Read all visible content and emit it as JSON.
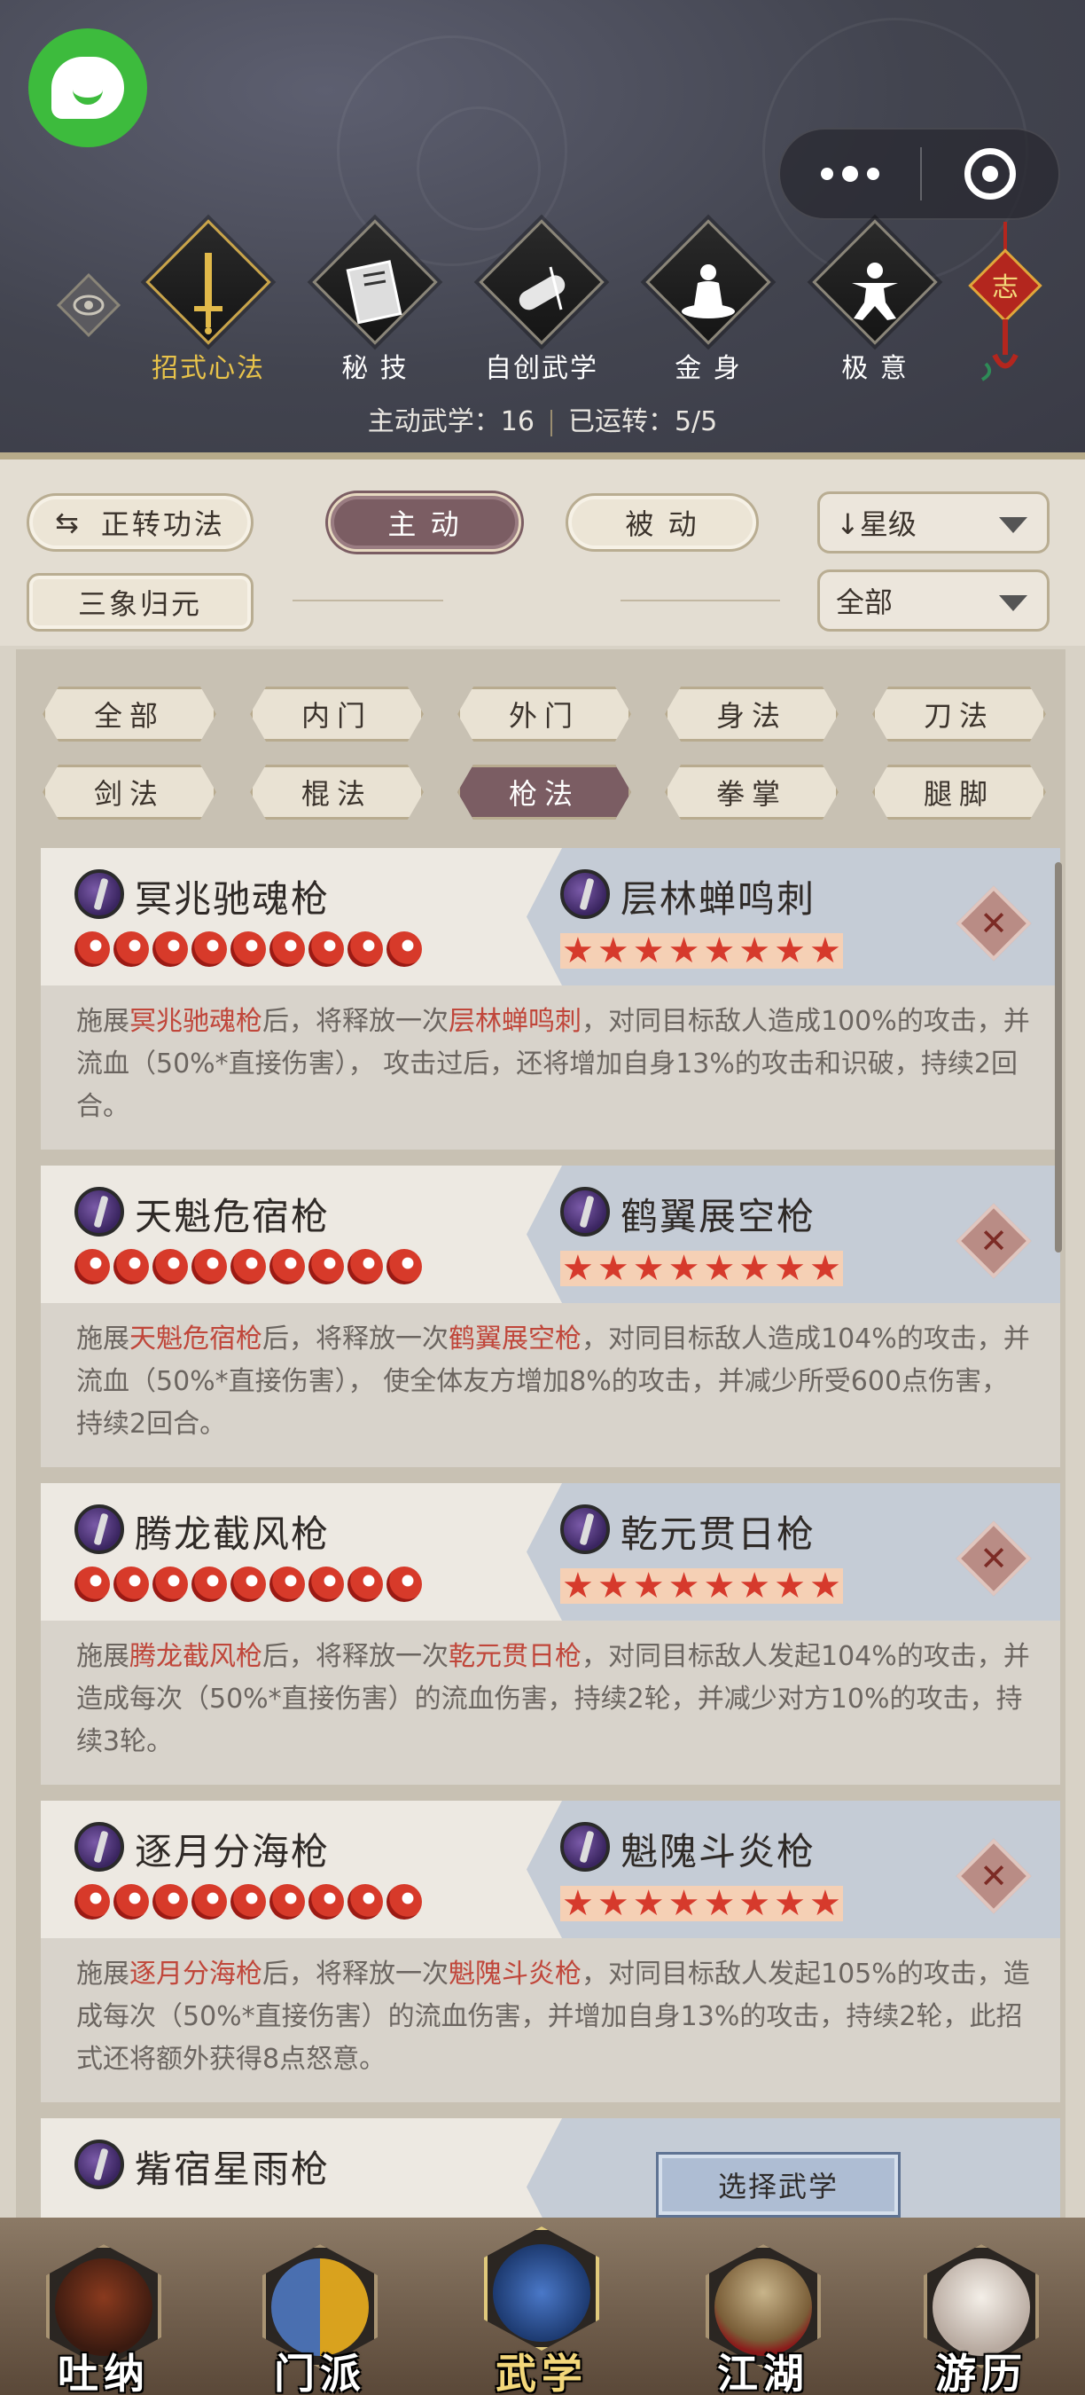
{
  "header": {
    "top_tabs": [
      {
        "label": "招式心法",
        "icon": "sword-icon",
        "active": true
      },
      {
        "label": "秘 技",
        "icon": "book-icon",
        "active": false
      },
      {
        "label": "自创武学",
        "icon": "scroll-icon",
        "active": false
      },
      {
        "label": "金 身",
        "icon": "meditation-icon",
        "active": false
      },
      {
        "label": "极 意",
        "icon": "martial-pose-icon",
        "active": false
      }
    ],
    "knot_char": "志",
    "status": {
      "active_label": "主动武学：16",
      "running_label": "已运转：5/5"
    }
  },
  "toolbar": {
    "switch_label": "正转功法",
    "active_label": "主 动",
    "passive_label": "被 动",
    "sort_label": "↓星级",
    "sanxiang_label": "三象归元",
    "filter_all_label": "全部"
  },
  "filters": [
    {
      "label": "全部",
      "active": false
    },
    {
      "label": "内门",
      "active": false
    },
    {
      "label": "外门",
      "active": false
    },
    {
      "label": "身法",
      "active": false
    },
    {
      "label": "刀法",
      "active": false
    },
    {
      "label": "剑法",
      "active": false
    },
    {
      "label": "棍法",
      "active": false
    },
    {
      "label": "枪法",
      "active": true
    },
    {
      "label": "拳掌",
      "active": false
    },
    {
      "label": "腿脚",
      "active": false
    }
  ],
  "combos": [
    {
      "left_name": "冥兆驰魂枪",
      "flames": 9,
      "right_name": "层林蝉鸣刺",
      "stars": 8,
      "desc_pre": "施展",
      "desc_hl1": "冥兆驰魂枪",
      "desc_mid": "后，将释放一次",
      "desc_hl2": "层林蝉鸣刺",
      "desc_post": "，对同目标敌人造成100%的攻击，并流血（50%*直接伤害）， 攻击过后，还将增加自身13%的攻击和识破，持续2回合。"
    },
    {
      "left_name": "天魁危宿枪",
      "flames": 9,
      "right_name": "鹤翼展空枪",
      "stars": 8,
      "desc_pre": "施展",
      "desc_hl1": "天魁危宿枪",
      "desc_mid": "后，将释放一次",
      "desc_hl2": "鹤翼展空枪",
      "desc_post": "，对同目标敌人造成104%的攻击，并流血（50%*直接伤害）， 使全体友方增加8%的攻击，并减少所受600点伤害，持续2回合。"
    },
    {
      "left_name": "腾龙截风枪",
      "flames": 9,
      "right_name": "乾元贯日枪",
      "stars": 8,
      "desc_pre": "施展",
      "desc_hl1": "腾龙截风枪",
      "desc_mid": "后，将释放一次",
      "desc_hl2": "乾元贯日枪",
      "desc_post": "，对同目标敌人发起104%的攻击，并造成每次（50%*直接伤害）的流血伤害，持续2轮，并减少对方10%的攻击，持续3轮。"
    },
    {
      "left_name": "逐月分海枪",
      "flames": 9,
      "right_name": "魁隗斗炎枪",
      "stars": 8,
      "desc_pre": "施展",
      "desc_hl1": "逐月分海枪",
      "desc_mid": "后，将释放一次",
      "desc_hl2": "魁隗斗炎枪",
      "desc_post": "，对同目标敌人发起105%的攻击，造成每次（50%*直接伤害）的流血伤害，并增加自身13%的攻击，持续2轮，此招式还将额外获得8点怒意。"
    }
  ],
  "last_combo": {
    "left_name": "觜宿星雨枪",
    "select_label": "选择武学"
  },
  "bottom_nav": [
    {
      "label": "吐纳",
      "active": false
    },
    {
      "label": "门派",
      "active": false
    },
    {
      "label": "武学",
      "active": true
    },
    {
      "label": "江湖",
      "active": false
    },
    {
      "label": "游历",
      "active": false
    }
  ],
  "colors": {
    "accent_active": "#7b5d63",
    "highlight_text": "#c0463a",
    "gold": "#e8c34a"
  }
}
